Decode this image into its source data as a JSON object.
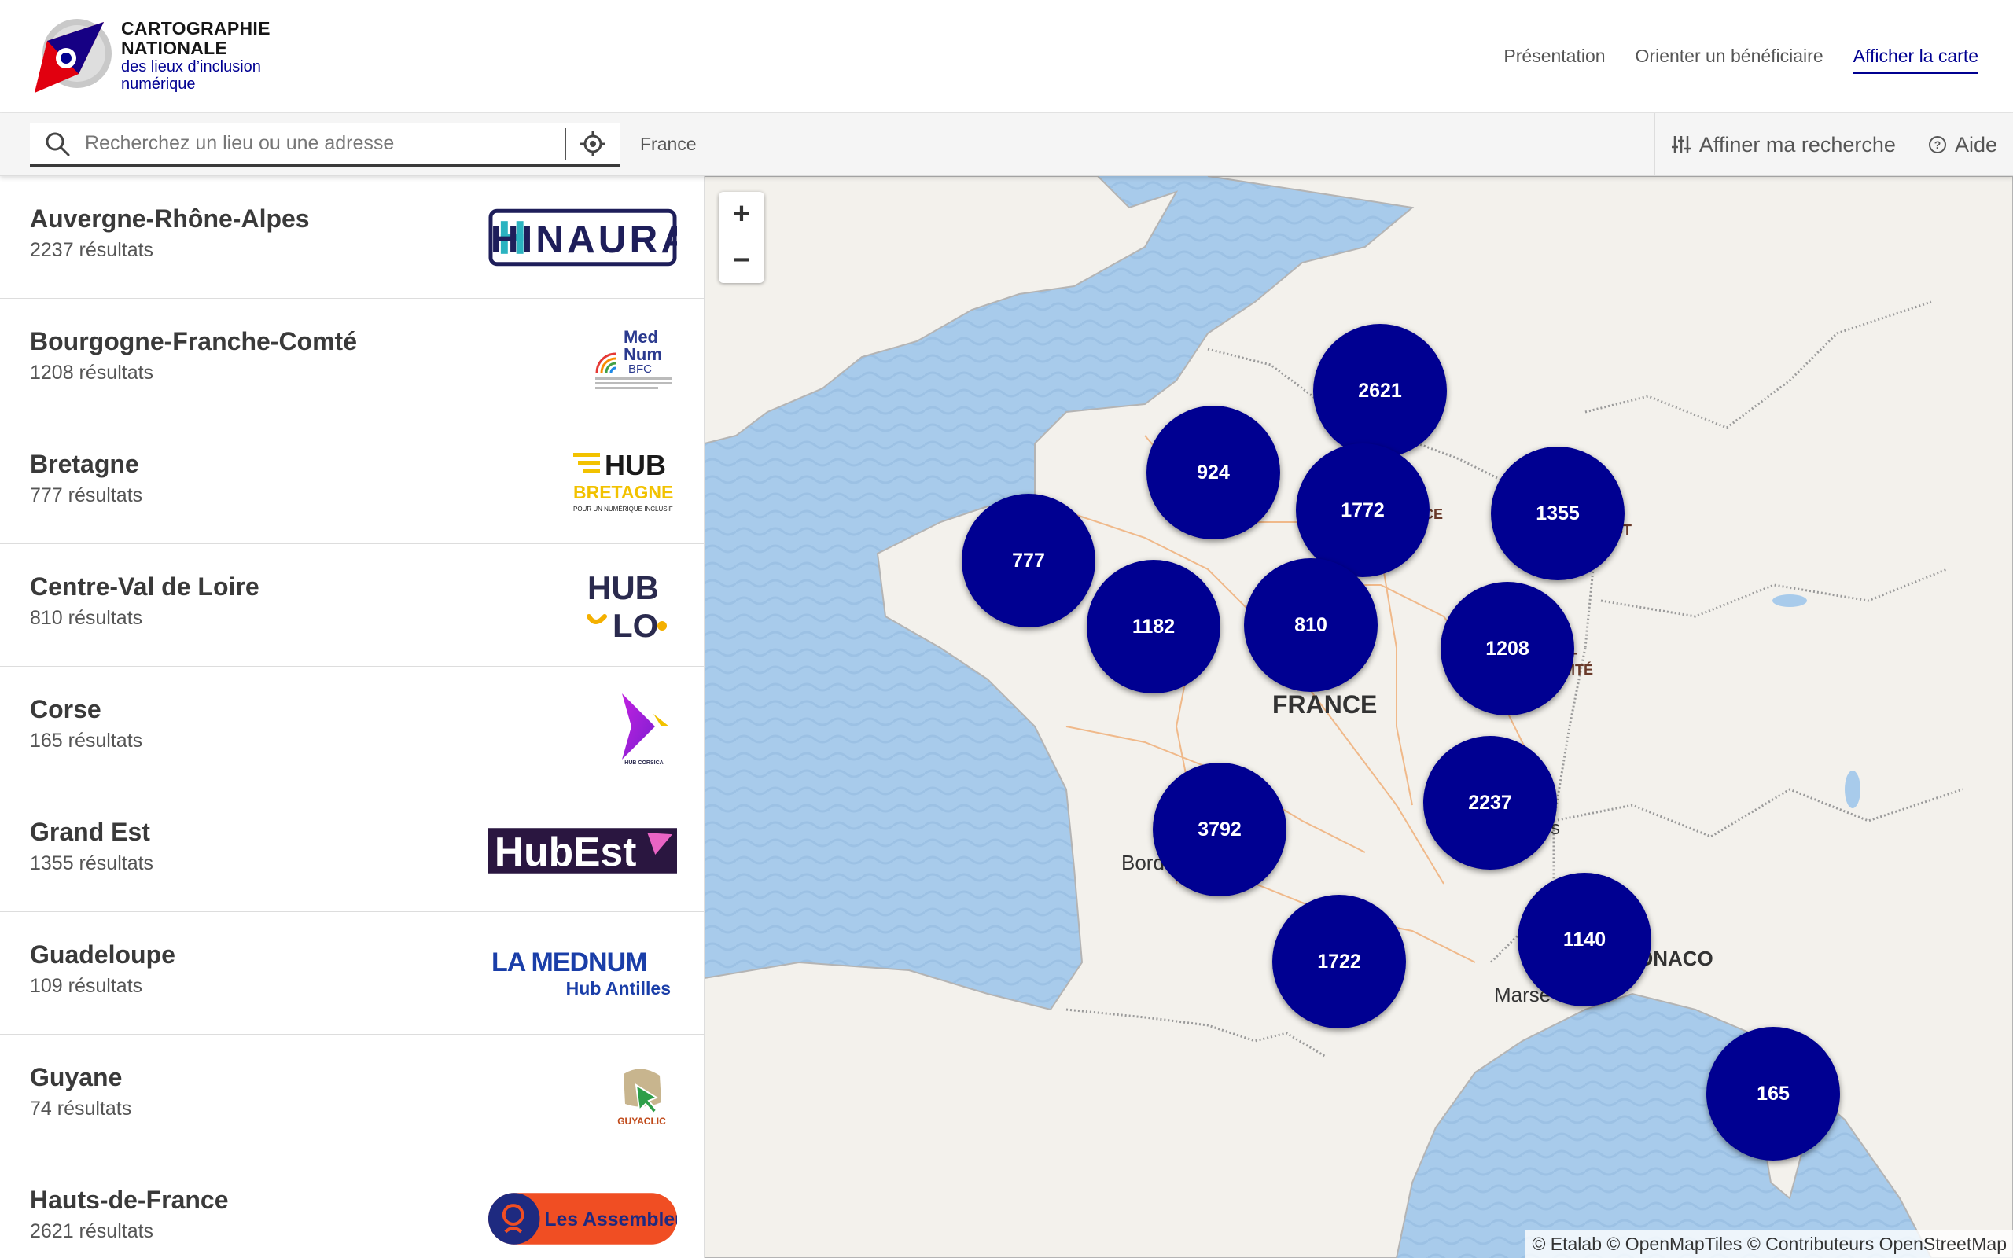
{
  "header": {
    "brand_line1": "CARTOGRAPHIE",
    "brand_line2": "NATIONALE",
    "brand_line3": "des lieux d’inclusion",
    "brand_line4": "numérique",
    "nav": [
      {
        "label": "Présentation",
        "active": false
      },
      {
        "label": "Orienter un bénéficiaire",
        "active": false
      },
      {
        "label": "Afficher la carte",
        "active": true
      }
    ]
  },
  "search": {
    "placeholder": "Recherchez un lieu ou une adresse",
    "location": "France",
    "refine_label": "Affiner ma recherche",
    "help_label": "Aide"
  },
  "regions": [
    {
      "name": "Auvergne-Rhône-Alpes",
      "count": "2237 résultats",
      "logo": "HINAURA"
    },
    {
      "name": "Bourgogne-Franche-Comté",
      "count": "1208 résultats",
      "logo": "MedNum BFC"
    },
    {
      "name": "Bretagne",
      "count": "777 résultats",
      "logo": "HUB BRETAGNE"
    },
    {
      "name": "Centre-Val de Loire",
      "count": "810 résultats",
      "logo": "HUB LO"
    },
    {
      "name": "Corse",
      "count": "165 résultats",
      "logo": "HUB CORSICA"
    },
    {
      "name": "Grand Est",
      "count": "1355 résultats",
      "logo": "HubEst"
    },
    {
      "name": "Guadeloupe",
      "count": "109 résultats",
      "logo": "LA MEDNUM Hub Antilles"
    },
    {
      "name": "Guyane",
      "count": "74 résultats",
      "logo": "GUYACLIC"
    },
    {
      "name": "Hauts-de-France",
      "count": "2621 résultats",
      "logo": "Les Assembleurs"
    }
  ],
  "logo_text": {
    "hinaura": "HINAURA",
    "mednum_1": "Med",
    "mednum_2": "Num",
    "mednum_3": "BFC",
    "hub": "HUB",
    "bretagne": "BRETAGNE",
    "bretagne_tag": "POUR UN NUMÉRIQUE INCLUSIF",
    "lo": "LO",
    "corsica": "HUB CORSICA",
    "hubest": "HubEst",
    "lamednum": "LA MEDNUM",
    "antilles": "Hub Antilles",
    "guyaclic": "GUYACLIC",
    "assembleurs": "Les Assembleurs"
  },
  "map": {
    "zoom_in": "+",
    "zoom_out": "−",
    "country_label": "FRANCE",
    "label_bordeaux": "Bord",
    "label_marseille": "Marse",
    "label_monaco": "ONACO",
    "label_frag1": "CE",
    "label_frag2": "ST",
    "label_frag3": "E-",
    "label_frag4": "MTÉ",
    "label_frag5": "s",
    "clusters": [
      {
        "value": "2621"
      },
      {
        "value": "924"
      },
      {
        "value": "1772"
      },
      {
        "value": "1355"
      },
      {
        "value": "777"
      },
      {
        "value": "1182"
      },
      {
        "value": "810"
      },
      {
        "value": "1208"
      },
      {
        "value": "2237"
      },
      {
        "value": "3792"
      },
      {
        "value": "1722"
      },
      {
        "value": "1140"
      },
      {
        "value": "165"
      }
    ],
    "attribution": "© Etalab © OpenMapTiles © Contributeurs OpenStreetMap"
  },
  "colors": {
    "primary": "#000091",
    "sea": "#aacbe8",
    "land": "#f5f3ef"
  }
}
